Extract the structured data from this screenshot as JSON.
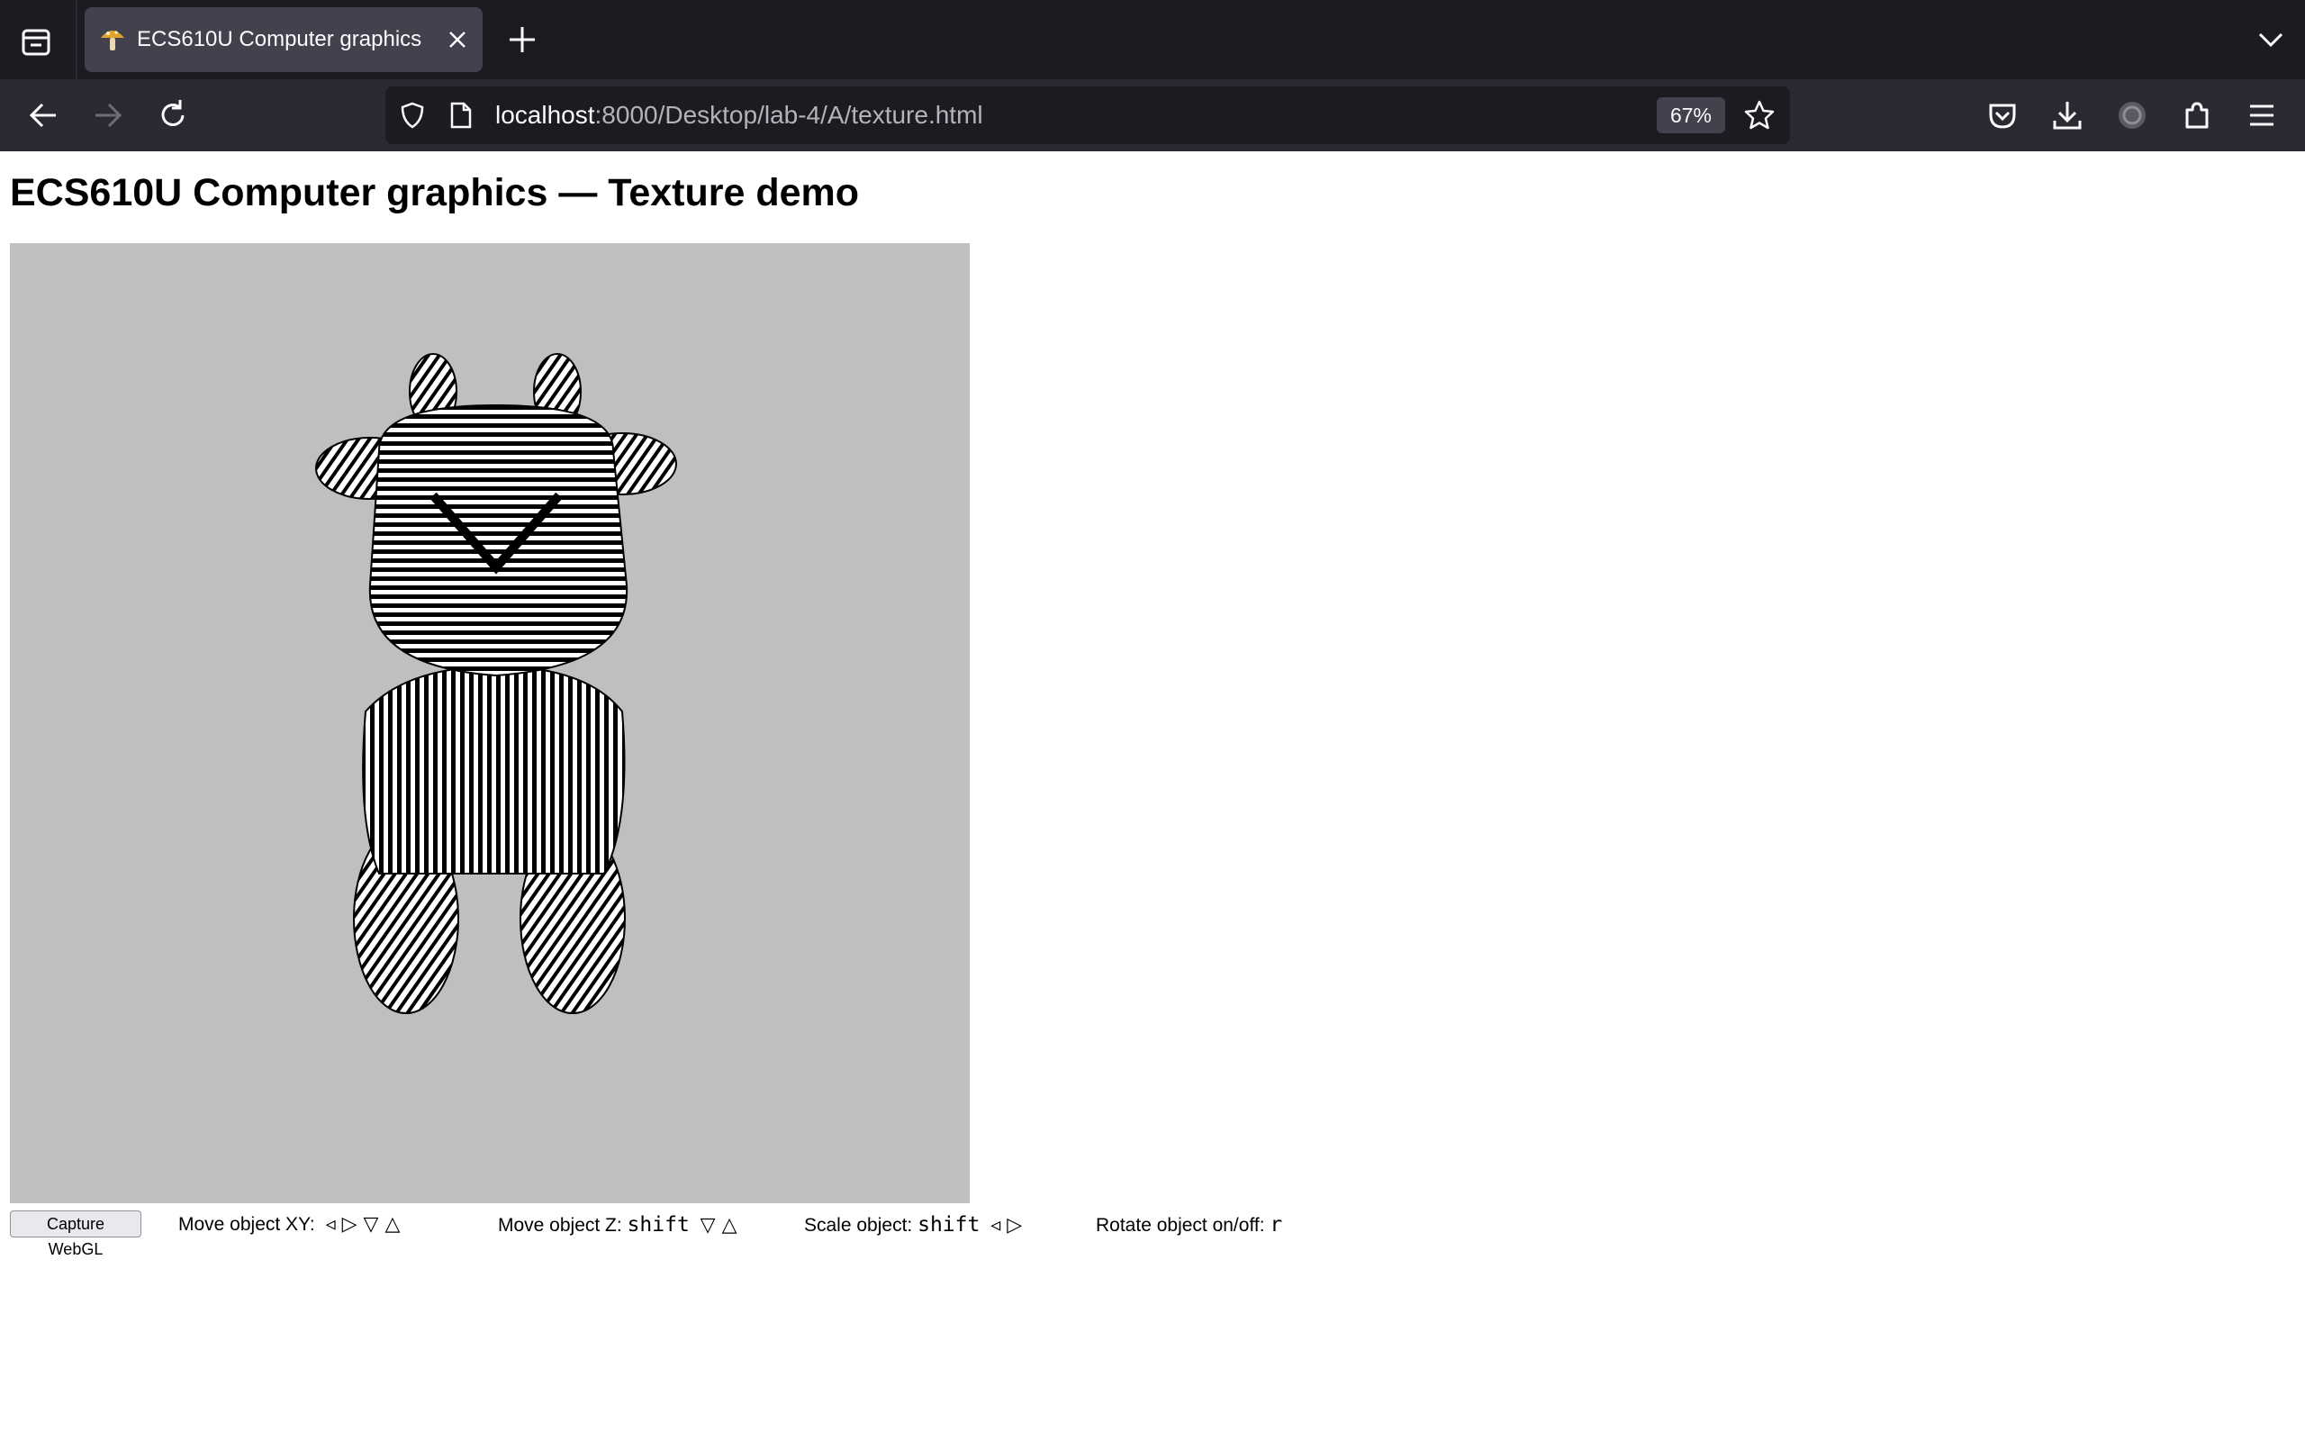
{
  "browser": {
    "tab": {
      "title": "ECS610U Computer graphics",
      "favicon": "mushroom-favicon"
    },
    "url": {
      "host": "localhost",
      "rest": ":8000/Desktop/lab-4/A/texture.html"
    },
    "zoom": "67%"
  },
  "page": {
    "title": "ECS610U Computer graphics — Texture demo"
  },
  "controls": {
    "capture_label": "Capture WebGL",
    "move_xy_label": "Move object XY:",
    "move_xy_keys": "◃ ▷ ▽ △",
    "move_z_label": "Move object Z:",
    "move_z_modifier": "shift",
    "move_z_keys": "▽ △",
    "scale_label": "Scale object:",
    "scale_modifier": "shift",
    "scale_keys": "◃ ▷",
    "rotate_label": "Rotate object on/off:",
    "rotate_key": "r"
  },
  "colors": {
    "chrome_dark": "#1c1b22",
    "chrome_mid": "#2b2a33",
    "canvas_bg": "#bfbfbf"
  }
}
